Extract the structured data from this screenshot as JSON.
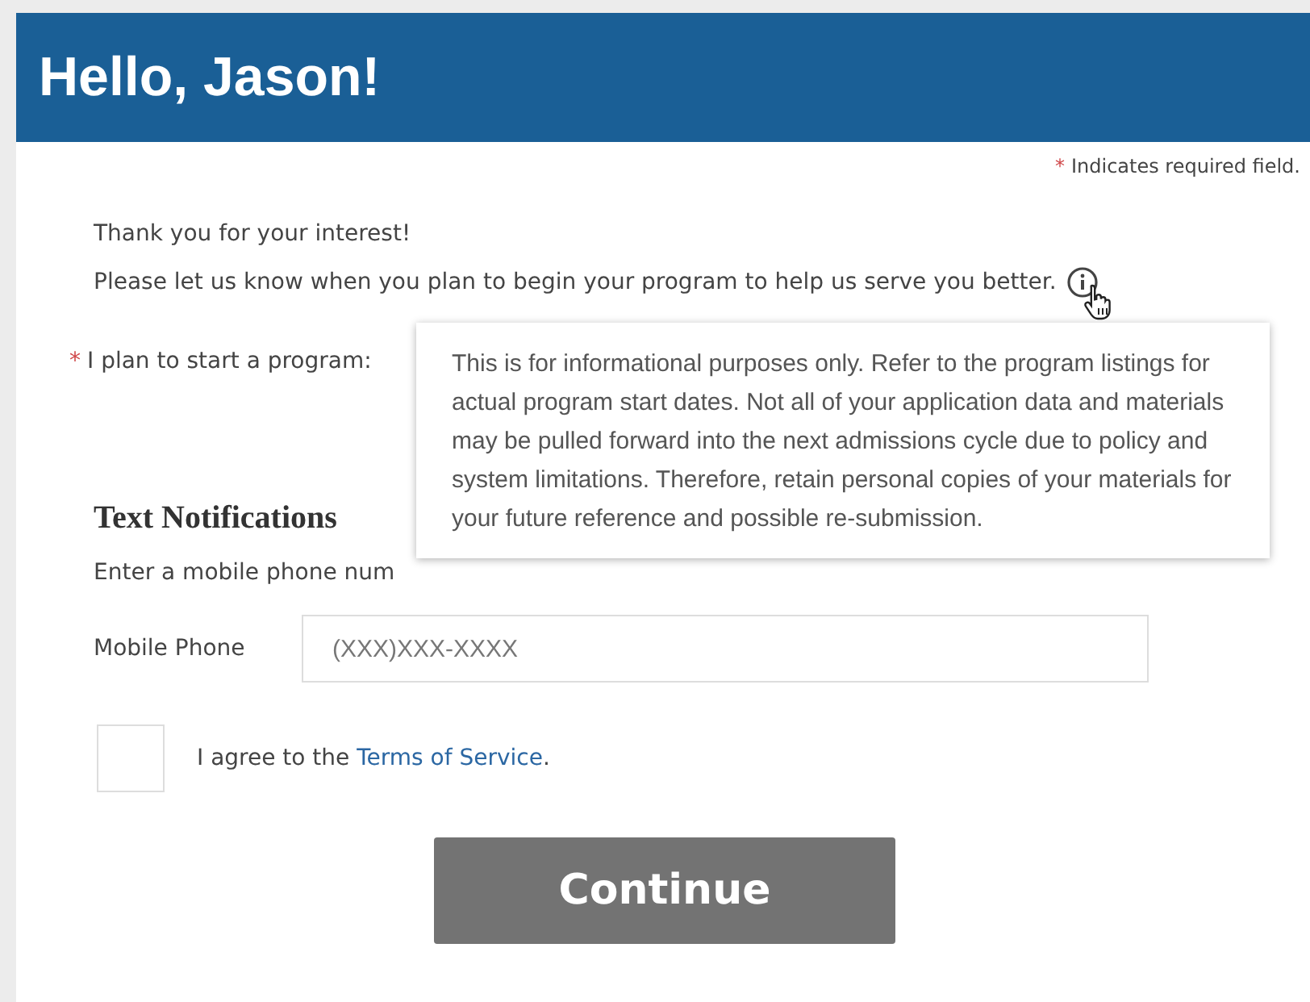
{
  "header": {
    "title": "Hello, Jason!"
  },
  "required_note": {
    "asterisk": "*",
    "text": "Indicates required field."
  },
  "intro": [
    "Thank you for your interest!",
    "Please let us know when you plan to begin your program to help us serve you better."
  ],
  "start_program": {
    "asterisk": "*",
    "label": "I plan to start a program:"
  },
  "tooltip": {
    "text": "This is for informational purposes only. Refer to the program listings for actual program start dates. Not all of your application data and materials may be pulled forward into the next admissions cycle due to policy and system limitations. Therefore, retain personal copies of your materials for your future reference and possible re-submission."
  },
  "text_notifications": {
    "heading": "Text Notifications",
    "description": "Enter a mobile phone num",
    "phone": {
      "label": "Mobile Phone",
      "placeholder": "(XXX)XXX-XXXX"
    }
  },
  "terms": {
    "checked": false,
    "text": "I agree to the",
    "link": "Terms of Service",
    "end": "."
  },
  "continue_button": "Continue"
}
